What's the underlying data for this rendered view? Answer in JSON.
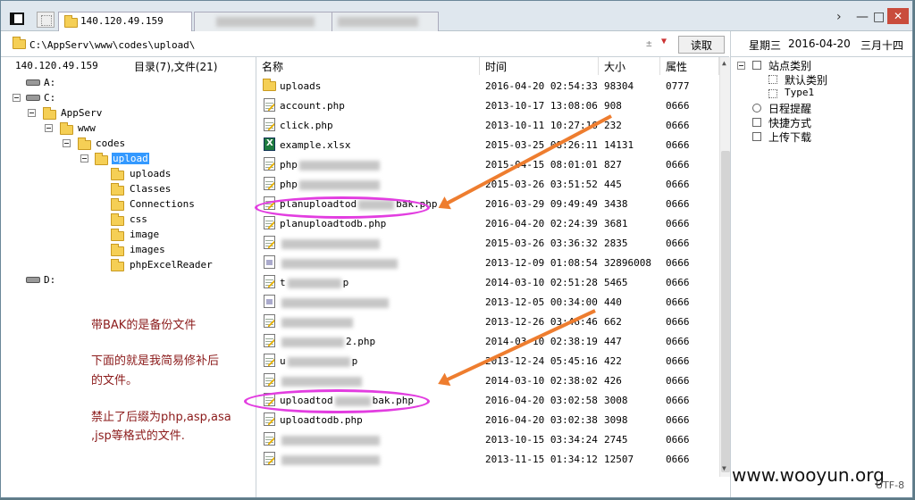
{
  "window": {
    "tabs": [
      {
        "label": "140.120.49.159",
        "active": true
      },
      {
        "label": "",
        "active": false
      }
    ],
    "controls": {
      "chevron": "›",
      "minimize": "—",
      "maximize": "□",
      "close": "✕"
    }
  },
  "address": {
    "path": "C:\\AppServ\\www\\codes\\upload\\",
    "plusminus": "±",
    "read_button": "读取"
  },
  "datebar": {
    "weekday": "星期三",
    "date": "2016-04-20",
    "lunar": "三月十四"
  },
  "left_pane": {
    "host": "140.120.49.159",
    "summary": "目录(7),文件(21)",
    "tree": [
      {
        "label": "A:",
        "type": "drive"
      },
      {
        "label": "C:",
        "type": "drive"
      },
      {
        "label": "AppServ",
        "type": "folder"
      },
      {
        "label": "www",
        "type": "folder"
      },
      {
        "label": "codes",
        "type": "folder"
      },
      {
        "label": "upload",
        "type": "folder",
        "selected": true
      },
      {
        "label": "uploads",
        "type": "folder"
      },
      {
        "label": "Classes",
        "type": "folder"
      },
      {
        "label": "Connections",
        "type": "folder"
      },
      {
        "label": "css",
        "type": "folder"
      },
      {
        "label": "image",
        "type": "folder"
      },
      {
        "label": "images",
        "type": "folder"
      },
      {
        "label": "phpExcelReader",
        "type": "folder"
      },
      {
        "label": "D:",
        "type": "drive"
      }
    ],
    "note": {
      "line1": "带BAK的是备份文件",
      "line2": "下面的就是我简易修补后",
      "line3": "的文件。",
      "line4": "禁止了后缀为php,asp,asa",
      "line5": ",jsp等格式的文件."
    }
  },
  "file_list": {
    "columns": {
      "name": "名称",
      "time": "时间",
      "size": "大小",
      "attr": "属性"
    },
    "rows": [
      {
        "icon": "folder",
        "name": "uploads",
        "time": "2016-04-20 02:54:33",
        "size": "98304",
        "attr": "0777"
      },
      {
        "icon": "php",
        "name": "account.php",
        "time": "2013-10-17 13:08:06",
        "size": "908",
        "attr": "0666"
      },
      {
        "icon": "php",
        "name": "click.php",
        "time": "2013-10-11 10:27:16",
        "size": "232",
        "attr": "0666"
      },
      {
        "icon": "xlsx",
        "name": "example.xlsx",
        "time": "2015-03-25 08:26:11",
        "size": "14131",
        "attr": "0666"
      },
      {
        "icon": "php",
        "name": "php",
        "time": "2015-04-15 08:01:01",
        "size": "827",
        "attr": "0666"
      },
      {
        "icon": "php",
        "name": "php",
        "time": "2015-03-26 03:51:52",
        "size": "445",
        "attr": "0666"
      },
      {
        "icon": "php",
        "name": "planuploadtod",
        "name_suffix": "bak.php",
        "time": "2016-03-29 09:49:49",
        "size": "3438",
        "attr": "0666"
      },
      {
        "icon": "php",
        "name": "planuploadtodb.php",
        "time": "2016-04-20 02:24:39",
        "size": "3681",
        "attr": "0666"
      },
      {
        "icon": "php",
        "name": "",
        "time": "2015-03-26 03:36:32",
        "size": "2835",
        "attr": "0666"
      },
      {
        "icon": "gen",
        "name": "",
        "time": "2013-12-09 01:08:54",
        "size": "32896008",
        "attr": "0666"
      },
      {
        "icon": "php",
        "name": "t",
        "name_suffix": "p",
        "time": "2014-03-10 02:51:28",
        "size": "5465",
        "attr": "0666"
      },
      {
        "icon": "gen",
        "name": "",
        "time": "2013-12-05 00:34:00",
        "size": "440",
        "attr": "0666"
      },
      {
        "icon": "php",
        "name": "",
        "time": "2013-12-26 03:46:46",
        "size": "662",
        "attr": "0666"
      },
      {
        "icon": "php",
        "name": "",
        "name_suffix": "2.php",
        "time": "2014-03-10 02:38:19",
        "size": "447",
        "attr": "0666"
      },
      {
        "icon": "php",
        "name": "u",
        "name_suffix": "p",
        "time": "2013-12-24 05:45:16",
        "size": "422",
        "attr": "0666"
      },
      {
        "icon": "php",
        "name": "",
        "time": "2014-03-10 02:38:02",
        "size": "426",
        "attr": "0666"
      },
      {
        "icon": "php",
        "name": "uploadtod",
        "name_suffix": "bak.php",
        "time": "2016-04-20 03:02:58",
        "size": "3008",
        "attr": "0666"
      },
      {
        "icon": "php",
        "name": "uploadtodb.php",
        "time": "2016-04-20 03:02:38",
        "size": "3098",
        "attr": "0666"
      },
      {
        "icon": "php",
        "name": "",
        "time": "2013-10-15 03:34:24",
        "size": "2745",
        "attr": "0666"
      },
      {
        "icon": "php",
        "name": "",
        "time": "2013-11-15 01:34:12",
        "size": "12507",
        "attr": "0666"
      }
    ]
  },
  "right_pane": {
    "items": [
      {
        "label": "站点类别",
        "icon": "category-icon"
      },
      {
        "label": "默认类别",
        "icon": "default-category-icon"
      },
      {
        "label": "Type1",
        "icon": "type-icon"
      },
      {
        "label": "日程提醒",
        "icon": "schedule-icon"
      },
      {
        "label": "快捷方式",
        "icon": "shortcut-icon"
      },
      {
        "label": "上传下载",
        "icon": "upload-download-icon"
      }
    ]
  },
  "footer": {
    "watermark": "www.wooyun.org",
    "encoding": "UTF-8"
  },
  "colors": {
    "annotation_arrow": "#ee7d2f",
    "annotation_circle": "#e23de0",
    "note_text": "#8b1a1a",
    "selection": "#3399ff"
  }
}
